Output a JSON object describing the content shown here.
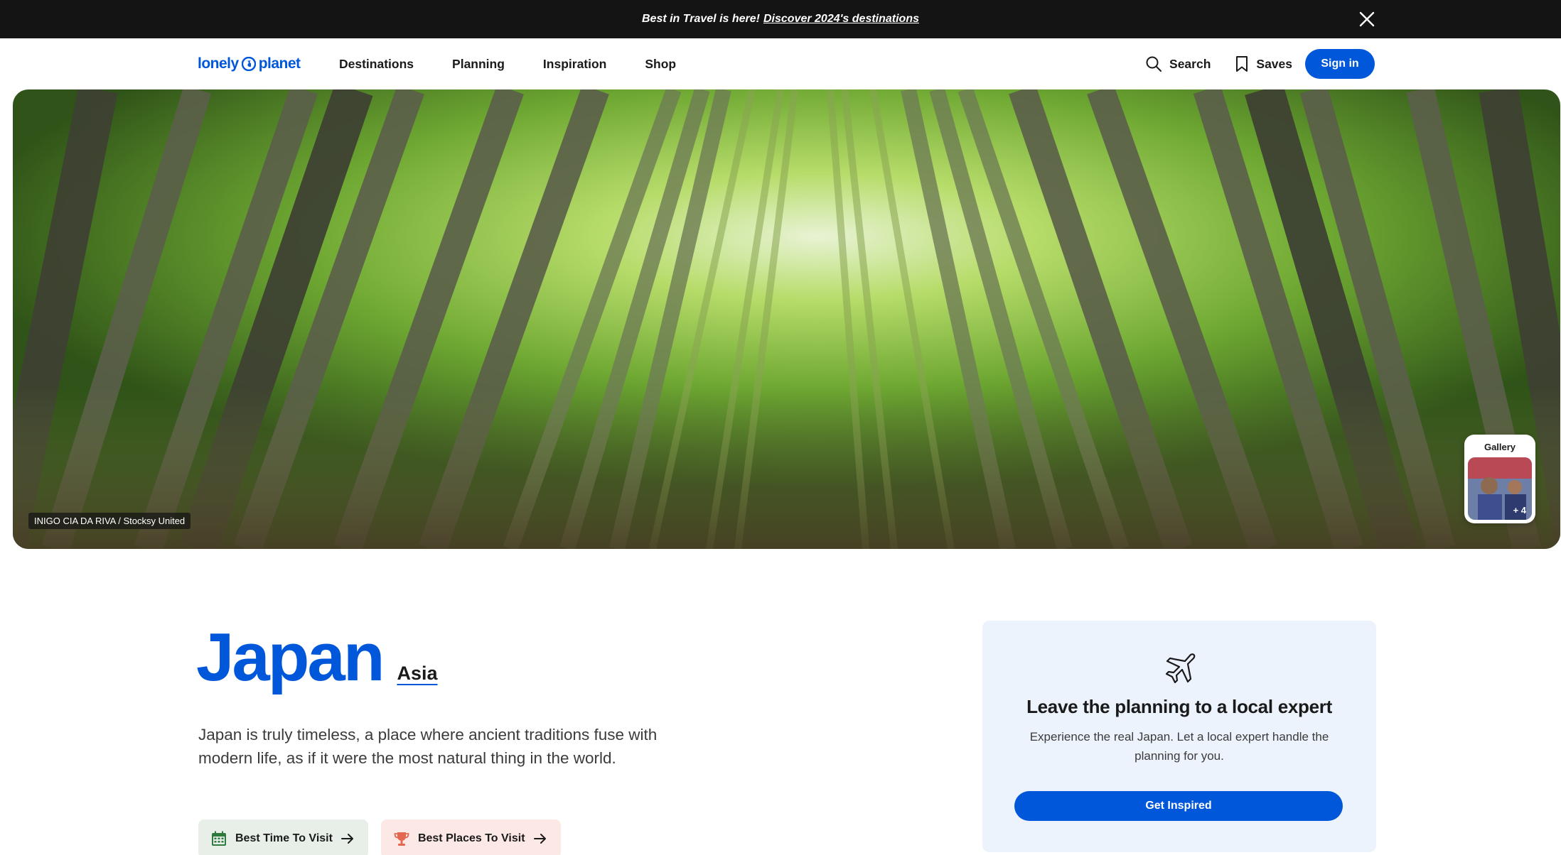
{
  "promo": {
    "text": "Best in Travel is here!",
    "link": "Discover 2024's destinations",
    "close_icon": "close-icon"
  },
  "header": {
    "logo_left": "lonely",
    "logo_right": "planet",
    "nav": [
      "Destinations",
      "Planning",
      "Inspiration",
      "Shop"
    ],
    "search_label": "Search",
    "saves_label": "Saves",
    "signin_label": "Sign in",
    "brand_color": "#0057d9"
  },
  "hero": {
    "photo_credit": "INIGO CIA DA RIVA / Stocksy United",
    "gallery_label": "Gallery",
    "gallery_count": "+ 4"
  },
  "destination": {
    "title": "Japan",
    "region": "Asia",
    "intro": "Japan is truly timeless, a place where ancient traditions fuse with modern life, as if it were the most natural thing in the world.",
    "pills": [
      {
        "label": "Best Time To Visit",
        "icon": "calendar-icon",
        "color": "#e8efe9"
      },
      {
        "label": "Best Places To Visit",
        "icon": "trophy-icon",
        "color": "#fce9e6"
      }
    ]
  },
  "expert": {
    "icon": "airplane-icon",
    "title": "Leave the planning to a local expert",
    "text": "Experience the real Japan. Let a local expert handle the planning for you.",
    "button": "Get Inspired"
  }
}
